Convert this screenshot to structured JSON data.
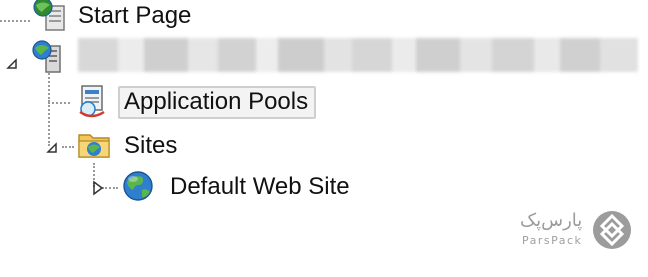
{
  "tree": {
    "start_page": {
      "label": "Start Page",
      "icon": "start-page-icon"
    },
    "server": {
      "label_obscured": true,
      "icon": "server-icon",
      "expanded": true
    },
    "application_pools": {
      "label": "Application Pools",
      "icon": "application-pools-icon",
      "selected": true
    },
    "sites": {
      "label": "Sites",
      "icon": "folder-globe-icon",
      "expanded": true
    },
    "default_web_site": {
      "label": "Default Web Site",
      "icon": "globe-icon",
      "expanded": false
    }
  },
  "watermark": {
    "name_fa": "پارس‌پک",
    "name_en": "ParsPack",
    "icon": "parspack-logo-icon"
  },
  "colors": {
    "selection_border": "#cfcfcf",
    "selection_bg": "#f3f3f3",
    "tree_lines": "#9a9a9a",
    "watermark_gray": "#9c9c9c"
  }
}
